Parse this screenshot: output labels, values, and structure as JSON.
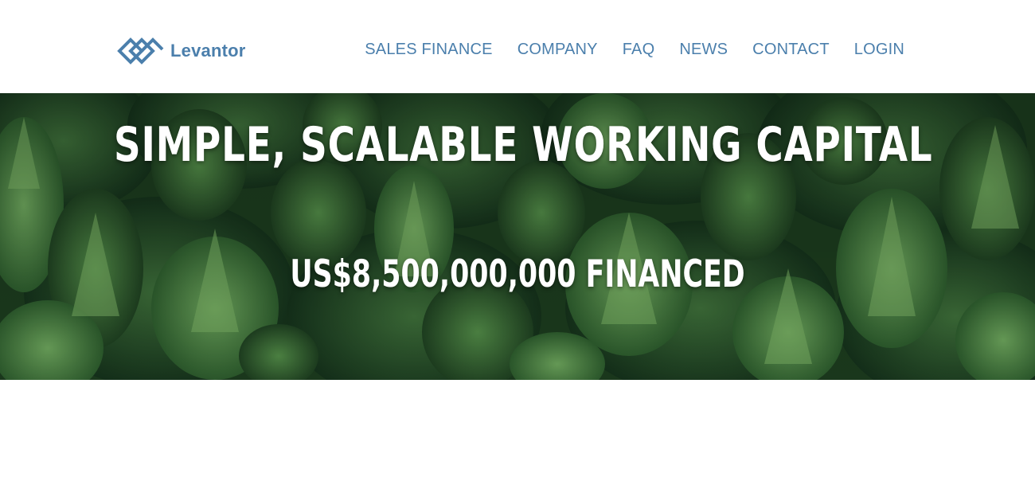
{
  "brand": {
    "name": "Levantor",
    "logo_icon": "levantor-diamond-logo-icon",
    "color": "#4b7fac"
  },
  "nav": {
    "items": [
      {
        "label": "SALES FINANCE"
      },
      {
        "label": "COMPANY"
      },
      {
        "label": "FAQ"
      },
      {
        "label": "NEWS"
      },
      {
        "label": "CONTACT"
      },
      {
        "label": "LOGIN"
      }
    ]
  },
  "hero": {
    "title": "SIMPLE, SCALABLE WORKING CAPITAL",
    "stat": "US$8,500,000,000 FINANCED",
    "background": "forest-aerial-image",
    "colors": {
      "dark": "#1c3a1e",
      "mid": "#2f5a2e",
      "light": "#5f9350"
    }
  }
}
